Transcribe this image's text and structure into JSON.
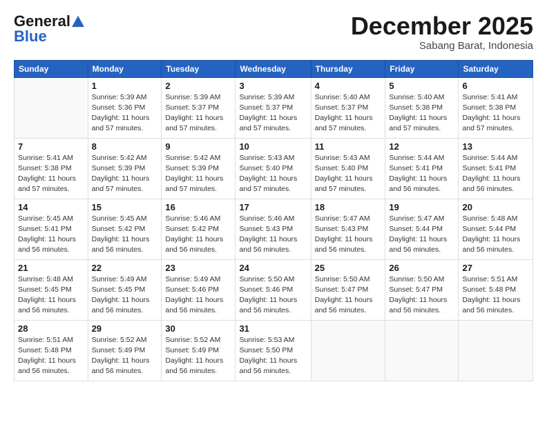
{
  "logo": {
    "general": "General",
    "blue": "Blue"
  },
  "header": {
    "month": "December 2025",
    "location": "Sabang Barat, Indonesia"
  },
  "weekdays": [
    "Sunday",
    "Monday",
    "Tuesday",
    "Wednesday",
    "Thursday",
    "Friday",
    "Saturday"
  ],
  "weeks": [
    [
      {
        "day": "",
        "info": ""
      },
      {
        "day": "1",
        "info": "Sunrise: 5:39 AM\nSunset: 5:36 PM\nDaylight: 11 hours\nand 57 minutes."
      },
      {
        "day": "2",
        "info": "Sunrise: 5:39 AM\nSunset: 5:37 PM\nDaylight: 11 hours\nand 57 minutes."
      },
      {
        "day": "3",
        "info": "Sunrise: 5:39 AM\nSunset: 5:37 PM\nDaylight: 11 hours\nand 57 minutes."
      },
      {
        "day": "4",
        "info": "Sunrise: 5:40 AM\nSunset: 5:37 PM\nDaylight: 11 hours\nand 57 minutes."
      },
      {
        "day": "5",
        "info": "Sunrise: 5:40 AM\nSunset: 5:38 PM\nDaylight: 11 hours\nand 57 minutes."
      },
      {
        "day": "6",
        "info": "Sunrise: 5:41 AM\nSunset: 5:38 PM\nDaylight: 11 hours\nand 57 minutes."
      }
    ],
    [
      {
        "day": "7",
        "info": "Sunrise: 5:41 AM\nSunset: 5:38 PM\nDaylight: 11 hours\nand 57 minutes."
      },
      {
        "day": "8",
        "info": "Sunrise: 5:42 AM\nSunset: 5:39 PM\nDaylight: 11 hours\nand 57 minutes."
      },
      {
        "day": "9",
        "info": "Sunrise: 5:42 AM\nSunset: 5:39 PM\nDaylight: 11 hours\nand 57 minutes."
      },
      {
        "day": "10",
        "info": "Sunrise: 5:43 AM\nSunset: 5:40 PM\nDaylight: 11 hours\nand 57 minutes."
      },
      {
        "day": "11",
        "info": "Sunrise: 5:43 AM\nSunset: 5:40 PM\nDaylight: 11 hours\nand 57 minutes."
      },
      {
        "day": "12",
        "info": "Sunrise: 5:44 AM\nSunset: 5:41 PM\nDaylight: 11 hours\nand 56 minutes."
      },
      {
        "day": "13",
        "info": "Sunrise: 5:44 AM\nSunset: 5:41 PM\nDaylight: 11 hours\nand 56 minutes."
      }
    ],
    [
      {
        "day": "14",
        "info": "Sunrise: 5:45 AM\nSunset: 5:41 PM\nDaylight: 11 hours\nand 56 minutes."
      },
      {
        "day": "15",
        "info": "Sunrise: 5:45 AM\nSunset: 5:42 PM\nDaylight: 11 hours\nand 56 minutes."
      },
      {
        "day": "16",
        "info": "Sunrise: 5:46 AM\nSunset: 5:42 PM\nDaylight: 11 hours\nand 56 minutes."
      },
      {
        "day": "17",
        "info": "Sunrise: 5:46 AM\nSunset: 5:43 PM\nDaylight: 11 hours\nand 56 minutes."
      },
      {
        "day": "18",
        "info": "Sunrise: 5:47 AM\nSunset: 5:43 PM\nDaylight: 11 hours\nand 56 minutes."
      },
      {
        "day": "19",
        "info": "Sunrise: 5:47 AM\nSunset: 5:44 PM\nDaylight: 11 hours\nand 56 minutes."
      },
      {
        "day": "20",
        "info": "Sunrise: 5:48 AM\nSunset: 5:44 PM\nDaylight: 11 hours\nand 56 minutes."
      }
    ],
    [
      {
        "day": "21",
        "info": "Sunrise: 5:48 AM\nSunset: 5:45 PM\nDaylight: 11 hours\nand 56 minutes."
      },
      {
        "day": "22",
        "info": "Sunrise: 5:49 AM\nSunset: 5:45 PM\nDaylight: 11 hours\nand 56 minutes."
      },
      {
        "day": "23",
        "info": "Sunrise: 5:49 AM\nSunset: 5:46 PM\nDaylight: 11 hours\nand 56 minutes."
      },
      {
        "day": "24",
        "info": "Sunrise: 5:50 AM\nSunset: 5:46 PM\nDaylight: 11 hours\nand 56 minutes."
      },
      {
        "day": "25",
        "info": "Sunrise: 5:50 AM\nSunset: 5:47 PM\nDaylight: 11 hours\nand 56 minutes."
      },
      {
        "day": "26",
        "info": "Sunrise: 5:50 AM\nSunset: 5:47 PM\nDaylight: 11 hours\nand 56 minutes."
      },
      {
        "day": "27",
        "info": "Sunrise: 5:51 AM\nSunset: 5:48 PM\nDaylight: 11 hours\nand 56 minutes."
      }
    ],
    [
      {
        "day": "28",
        "info": "Sunrise: 5:51 AM\nSunset: 5:48 PM\nDaylight: 11 hours\nand 56 minutes."
      },
      {
        "day": "29",
        "info": "Sunrise: 5:52 AM\nSunset: 5:49 PM\nDaylight: 11 hours\nand 56 minutes."
      },
      {
        "day": "30",
        "info": "Sunrise: 5:52 AM\nSunset: 5:49 PM\nDaylight: 11 hours\nand 56 minutes."
      },
      {
        "day": "31",
        "info": "Sunrise: 5:53 AM\nSunset: 5:50 PM\nDaylight: 11 hours\nand 56 minutes."
      },
      {
        "day": "",
        "info": ""
      },
      {
        "day": "",
        "info": ""
      },
      {
        "day": "",
        "info": ""
      }
    ]
  ]
}
